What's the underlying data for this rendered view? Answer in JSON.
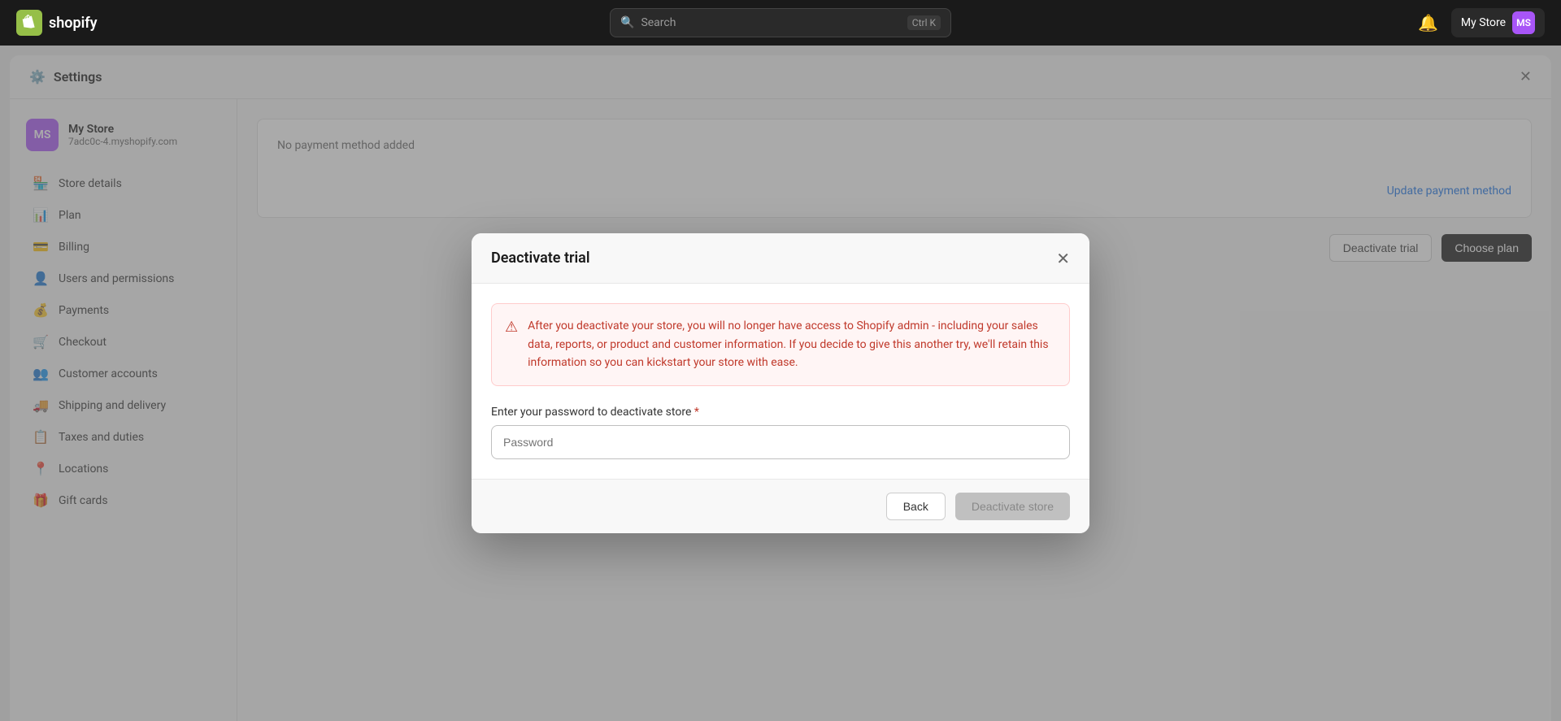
{
  "topbar": {
    "logo_text": "shopify",
    "logo_icon": "🛍",
    "search_placeholder": "Search",
    "search_shortcut": "Ctrl K",
    "store_name": "My Store",
    "avatar_initials": "MS"
  },
  "settings": {
    "title": "Settings",
    "close_label": "✕",
    "store_name": "My Store",
    "store_url": "7adc0c-4.myshopify.com",
    "store_initials": "MS"
  },
  "sidebar": {
    "items": [
      {
        "label": "Store details",
        "icon": "🏪"
      },
      {
        "label": "Plan",
        "icon": "📊"
      },
      {
        "label": "Billing",
        "icon": "💳"
      },
      {
        "label": "Users and permissions",
        "icon": "👤"
      },
      {
        "label": "Payments",
        "icon": "💰"
      },
      {
        "label": "Checkout",
        "icon": "🛒"
      },
      {
        "label": "Customer accounts",
        "icon": "👥"
      },
      {
        "label": "Shipping and delivery",
        "icon": "🚚"
      },
      {
        "label": "Taxes and duties",
        "icon": "📋"
      },
      {
        "label": "Locations",
        "icon": "📍"
      },
      {
        "label": "Gift cards",
        "icon": "🎁"
      }
    ]
  },
  "content": {
    "payment_info": "No payment method added",
    "update_payment_link": "Update payment method",
    "deactivate_trial_btn": "Deactivate trial",
    "choose_plan_btn": "Choose plan"
  },
  "modal": {
    "title": "Deactivate trial",
    "close_label": "✕",
    "warning_text": "After you deactivate your store, you will no longer have access to Shopify admin - including your sales data, reports, or product and customer information. If you decide to give this another try, we'll retain this information so you can kickstart your store with ease.",
    "field_label": "Enter your password to deactivate store",
    "field_required": "*",
    "password_placeholder": "Password",
    "back_btn": "Back",
    "deactivate_btn": "Deactivate store"
  }
}
